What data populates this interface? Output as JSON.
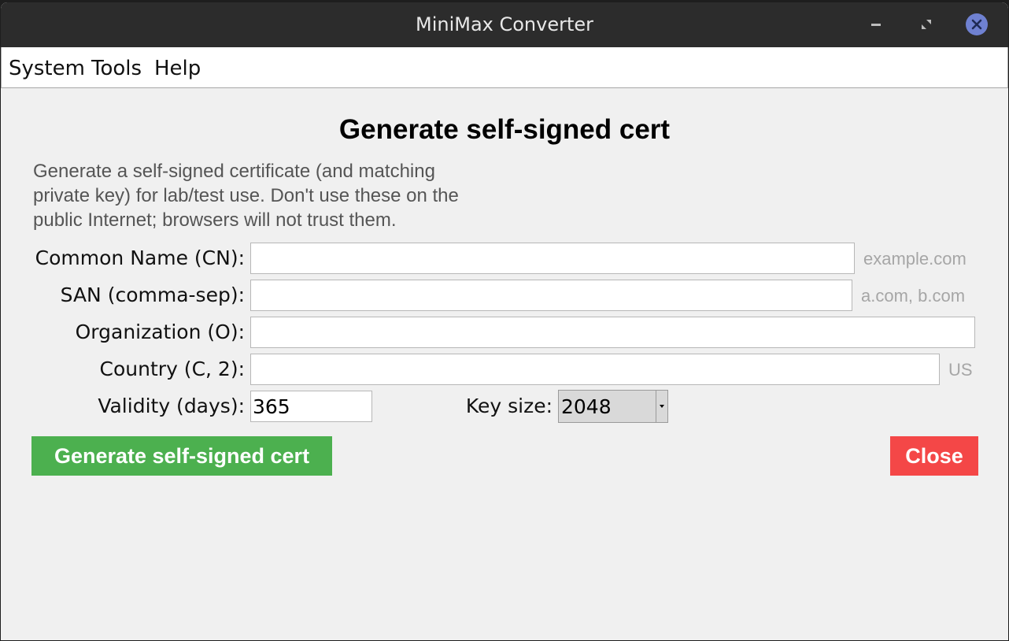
{
  "window": {
    "title": "MiniMax Converter"
  },
  "menubar": {
    "items": [
      "System",
      "Tools",
      "Help"
    ]
  },
  "dialog": {
    "heading": "Generate self-signed cert",
    "description_lines": [
      "Generate a self-signed certificate (and matching",
      "private key) for lab/test use. Don't use these on the",
      "public Internet; browsers will not trust them."
    ],
    "fields": {
      "cn": {
        "label": "Common Name (CN):",
        "value": "",
        "hint": "example.com"
      },
      "san": {
        "label": "SAN (comma-sep):",
        "value": "",
        "hint": "a.com, b.com"
      },
      "org": {
        "label": "Organization (O):",
        "value": ""
      },
      "country": {
        "label": "Country (C, 2):",
        "value": "",
        "hint": "US"
      },
      "validity": {
        "label": "Validity (days):",
        "value": "365"
      },
      "keysize": {
        "label": "Key size:",
        "value": "2048"
      }
    },
    "buttons": {
      "generate": "Generate self-signed cert",
      "close": "Close"
    }
  },
  "colors": {
    "generate_button": "#4cb04f",
    "close_button": "#f44747",
    "window_close_circle": "#6f81d1"
  }
}
